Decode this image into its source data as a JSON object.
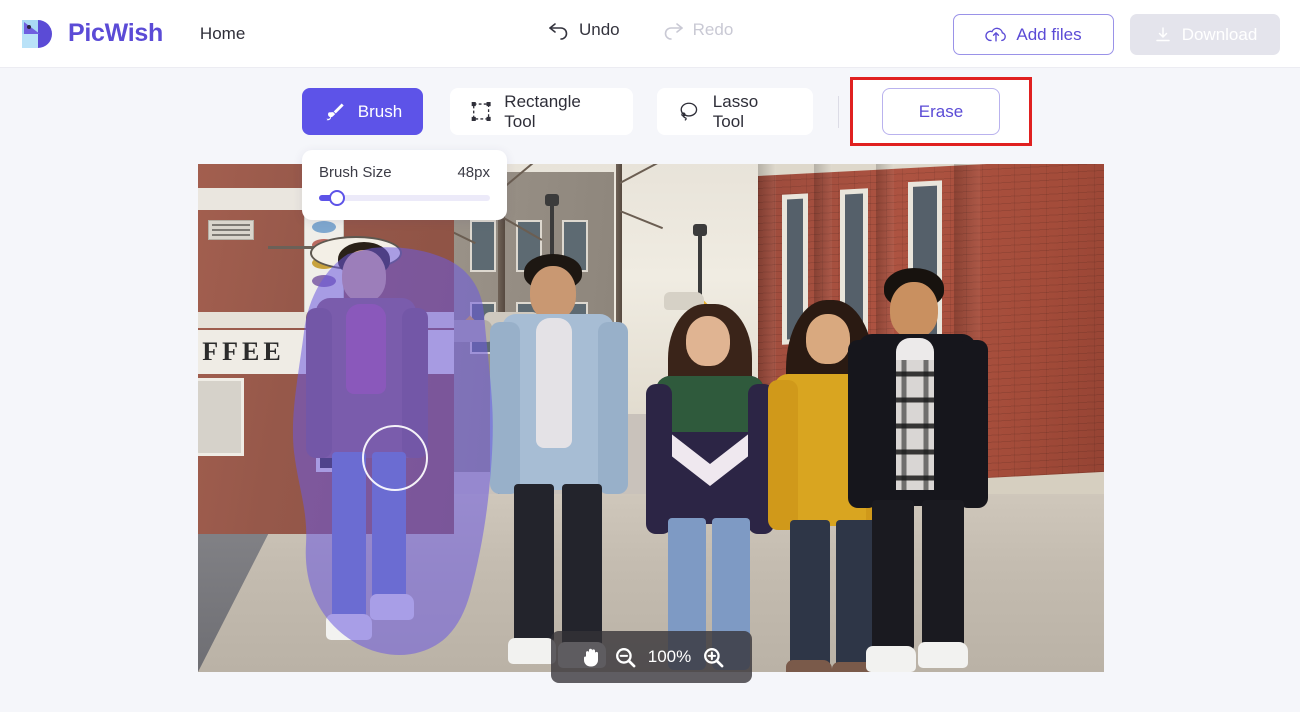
{
  "app": {
    "brand_name": "PicWish",
    "logo_icon": "picwish-logo-icon",
    "accent_color": "#5d53e8",
    "annotation_color": "#e02020"
  },
  "header": {
    "nav": {
      "home_label": "Home"
    },
    "history": {
      "undo_label": "Undo",
      "undo_icon": "undo-arrow-icon",
      "undo_enabled": "true",
      "redo_label": "Redo",
      "redo_icon": "redo-arrow-icon",
      "redo_enabled": "false"
    },
    "actions": {
      "add_files_label": "Add files",
      "add_files_icon": "cloud-upload-icon",
      "download_label": "Download",
      "download_icon": "download-icon",
      "download_enabled": "false"
    }
  },
  "toolbar": {
    "tools": [
      {
        "label": "Brush",
        "icon": "paintbrush-icon",
        "active": "true"
      },
      {
        "label": "Rectangle Tool",
        "icon": "rectangle-select-icon",
        "active": "false"
      },
      {
        "label": "Lasso Tool",
        "icon": "lasso-icon",
        "active": "false"
      }
    ],
    "erase_label": "Erase",
    "erase_highlighted": "true"
  },
  "brush_panel": {
    "title": "Brush Size",
    "value_label": "48px",
    "value": 48,
    "min": 1,
    "max": 400,
    "fill_percent": 9
  },
  "canvas": {
    "image_alt": "Five friends walking on a city sidewalk beside red brick buildings",
    "selection_mask": "purple-brush-mask",
    "mask_color": "#6b5ae0",
    "brush_cursor": "brush-cursor-circle"
  },
  "zoom_bar": {
    "pan_icon": "hand-pan-icon",
    "zoom_out_icon": "zoom-out-icon",
    "zoom_level": "100%",
    "zoom_in_icon": "zoom-in-icon"
  }
}
